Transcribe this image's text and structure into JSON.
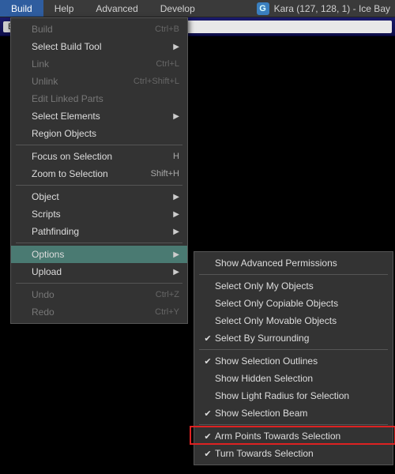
{
  "menubar": {
    "items": [
      {
        "label": "Build",
        "active": true
      },
      {
        "label": "Help"
      },
      {
        "label": "Advanced"
      },
      {
        "label": "Develop"
      }
    ],
    "party": {
      "icon_letter": "G",
      "text": "Kara (127, 128, 1) - Ice Bay"
    }
  },
  "toolbar": {
    "back_label": "Ba",
    "arrow": "▶"
  },
  "build_menu": {
    "items": [
      {
        "type": "item",
        "label": "Build",
        "accel": "Ctrl+B",
        "disabled": true
      },
      {
        "type": "item",
        "label": "Select Build Tool",
        "submenu": true
      },
      {
        "type": "item",
        "label": "Link",
        "accel": "Ctrl+L",
        "disabled": true
      },
      {
        "type": "item",
        "label": "Unlink",
        "accel": "Ctrl+Shift+L",
        "disabled": true
      },
      {
        "type": "item",
        "label": "Edit Linked Parts",
        "disabled": true
      },
      {
        "type": "item",
        "label": "Select Elements",
        "submenu": true
      },
      {
        "type": "item",
        "label": "Region Objects"
      },
      {
        "type": "sep"
      },
      {
        "type": "item",
        "label": "Focus on Selection",
        "accel": "H"
      },
      {
        "type": "item",
        "label": "Zoom to Selection",
        "accel": "Shift+H"
      },
      {
        "type": "sep"
      },
      {
        "type": "item",
        "label": "Object",
        "submenu": true
      },
      {
        "type": "item",
        "label": "Scripts",
        "submenu": true
      },
      {
        "type": "item",
        "label": "Pathfinding",
        "submenu": true
      },
      {
        "type": "sep"
      },
      {
        "type": "item",
        "label": "Options",
        "submenu": true,
        "highlight": true
      },
      {
        "type": "item",
        "label": "Upload",
        "submenu": true
      },
      {
        "type": "sep"
      },
      {
        "type": "item",
        "label": "Undo",
        "accel": "Ctrl+Z",
        "disabled": true
      },
      {
        "type": "item",
        "label": "Redo",
        "accel": "Ctrl+Y",
        "disabled": true
      }
    ]
  },
  "options_submenu": {
    "items": [
      {
        "type": "item",
        "label": "Show Advanced Permissions"
      },
      {
        "type": "sep"
      },
      {
        "type": "item",
        "label": "Select Only My Objects"
      },
      {
        "type": "item",
        "label": "Select Only Copiable Objects"
      },
      {
        "type": "item",
        "label": "Select Only Movable Objects"
      },
      {
        "type": "item",
        "label": "Select By Surrounding",
        "checked": true
      },
      {
        "type": "sep"
      },
      {
        "type": "item",
        "label": "Show Selection Outlines",
        "checked": true
      },
      {
        "type": "item",
        "label": "Show Hidden Selection"
      },
      {
        "type": "item",
        "label": "Show Light Radius for Selection"
      },
      {
        "type": "item",
        "label": "Show Selection Beam",
        "checked": true
      },
      {
        "type": "sep"
      },
      {
        "type": "item",
        "label": "Arm Points Towards Selection",
        "checked": true,
        "outlined": true
      },
      {
        "type": "item",
        "label": "Turn Towards Selection",
        "checked": true
      }
    ]
  }
}
